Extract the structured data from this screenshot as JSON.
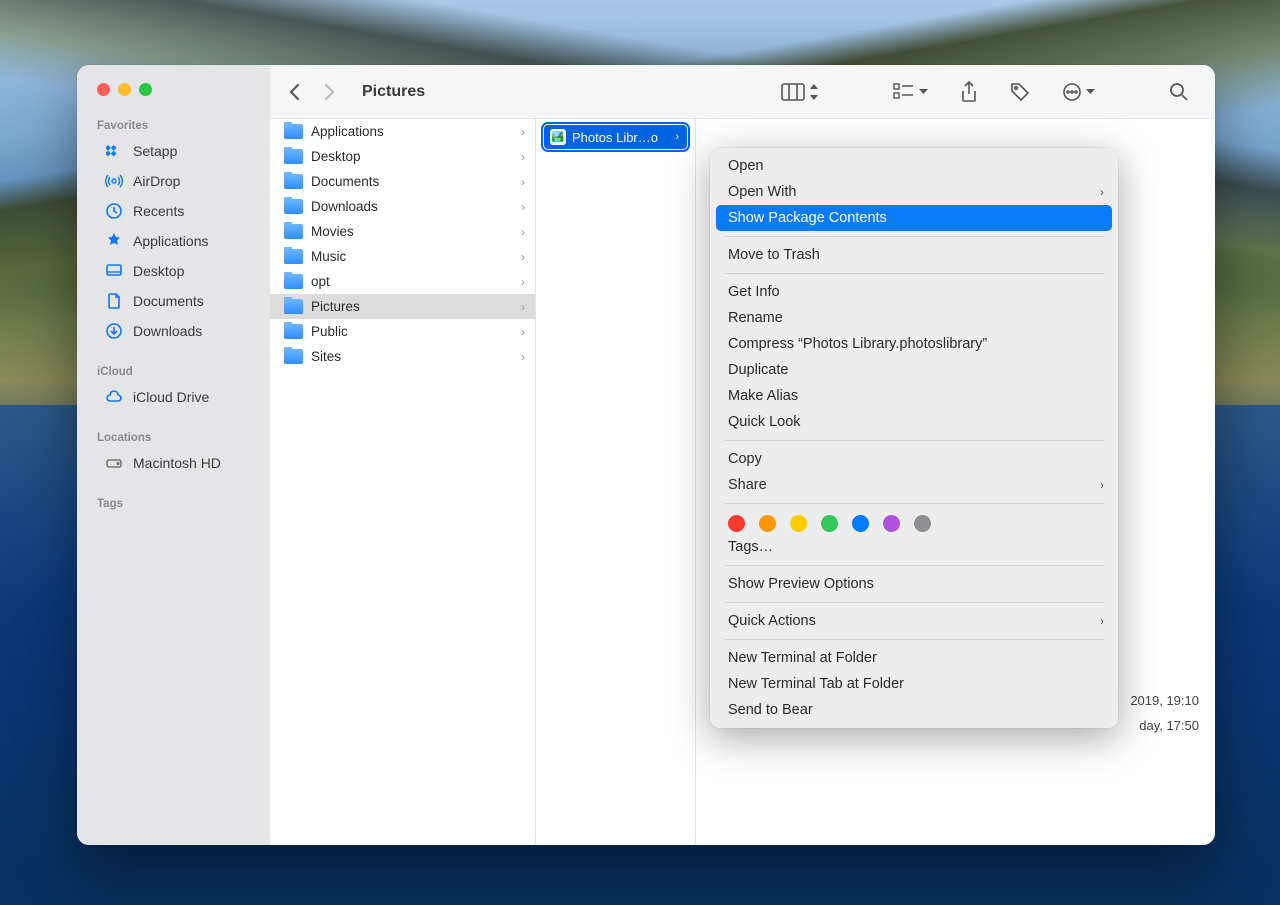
{
  "window_title": "Pictures",
  "sidebar": {
    "sections": [
      {
        "title": "Favorites",
        "items": [
          {
            "label": "Setapp",
            "icon": "setapp"
          },
          {
            "label": "AirDrop",
            "icon": "airdrop"
          },
          {
            "label": "Recents",
            "icon": "recents"
          },
          {
            "label": "Applications",
            "icon": "applications"
          },
          {
            "label": "Desktop",
            "icon": "desktop"
          },
          {
            "label": "Documents",
            "icon": "documents"
          },
          {
            "label": "Downloads",
            "icon": "downloads"
          }
        ]
      },
      {
        "title": "iCloud",
        "items": [
          {
            "label": "iCloud Drive",
            "icon": "icloud"
          }
        ]
      },
      {
        "title": "Locations",
        "items": [
          {
            "label": "Macintosh HD",
            "icon": "hd"
          }
        ]
      },
      {
        "title": "Tags",
        "items": []
      }
    ]
  },
  "columns": {
    "col1": [
      {
        "label": "Applications",
        "has_children": true
      },
      {
        "label": "Desktop",
        "has_children": true
      },
      {
        "label": "Documents",
        "has_children": true
      },
      {
        "label": "Downloads",
        "has_children": true
      },
      {
        "label": "Movies",
        "has_children": true
      },
      {
        "label": "Music",
        "has_children": true
      },
      {
        "label": "opt",
        "has_children": true
      },
      {
        "label": "Pictures",
        "has_children": true,
        "selected": true
      },
      {
        "label": "Public",
        "has_children": true
      },
      {
        "label": "Sites",
        "has_children": true
      }
    ],
    "col2_selected": "Photos Libr…o"
  },
  "preview": {
    "created_line": "2019, 19:10",
    "modified_line": "day, 17:50"
  },
  "context_menu": {
    "groups": [
      [
        {
          "label": "Open"
        },
        {
          "label": "Open With",
          "submenu": true
        },
        {
          "label": "Show Package Contents",
          "highlighted": true
        }
      ],
      [
        {
          "label": "Move to Trash"
        }
      ],
      [
        {
          "label": "Get Info"
        },
        {
          "label": "Rename"
        },
        {
          "label": "Compress “Photos Library.photoslibrary”"
        },
        {
          "label": "Duplicate"
        },
        {
          "label": "Make Alias"
        },
        {
          "label": "Quick Look"
        }
      ],
      [
        {
          "label": "Copy"
        },
        {
          "label": "Share",
          "submenu": true
        }
      ]
    ],
    "tag_colors": [
      "#ff3b30",
      "#ff9500",
      "#ffcc00",
      "#34c759",
      "#007aff",
      "#af52de",
      "#8e8e93"
    ],
    "tags_label": "Tags…",
    "after_tags": [
      [
        {
          "label": "Show Preview Options"
        }
      ],
      [
        {
          "label": "Quick Actions",
          "submenu": true
        }
      ],
      [
        {
          "label": "New Terminal at Folder"
        },
        {
          "label": "New Terminal Tab at Folder"
        },
        {
          "label": "Send to Bear"
        }
      ]
    ]
  }
}
